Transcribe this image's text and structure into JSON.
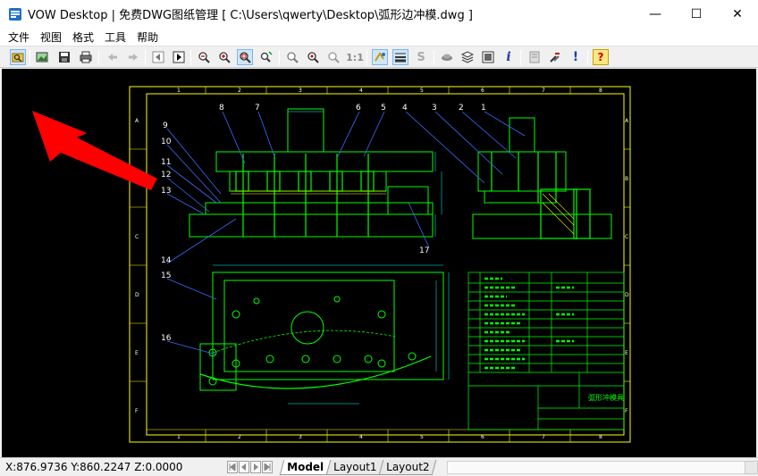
{
  "window": {
    "title": "VOW Desktop | 免费DWG图纸管理 [ C:\\Users\\qwerty\\Desktop\\弧形边冲模.dwg ]",
    "icon": "app-icon"
  },
  "window_controls": {
    "minimize": "—",
    "maximize": "☐",
    "close": "✕"
  },
  "menu": [
    "文件",
    "视图",
    "格式",
    "工具",
    "帮助"
  ],
  "toolbar_icons": [
    "open-file-icon",
    "image-icon",
    "save-icon",
    "print-icon",
    "undo-icon",
    "redo-icon",
    "prev-view-icon",
    "next-view-icon",
    "zoom-out-icon",
    "zoom-in-icon",
    "zoom-window-icon",
    "zoom-realtime-icon",
    "zoom-extents-icon",
    "zoom-center-icon",
    "zoom-previous-icon",
    "zoom-one-to-one-icon",
    "layer-visibility-icon",
    "line-weight-icon",
    "snap-s-icon",
    "3d-view-icon",
    "layers-icon",
    "layout-icon",
    "info-icon",
    "print-preview-icon",
    "tools-icon",
    "alert-icon",
    "help-icon"
  ],
  "labels": {
    "one_to_one": "1:1",
    "s": "S",
    "info": "i",
    "alert": "!",
    "help": "?"
  },
  "drawing": {
    "part_numbers_top": [
      "8",
      "7",
      "6",
      "5",
      "4",
      "3",
      "2",
      "1"
    ],
    "part_numbers_left": [
      "9",
      "10",
      "11",
      "12",
      "13",
      "14",
      "15",
      "16",
      "17"
    ],
    "grid_letters": [
      "A",
      "B",
      "C",
      "D",
      "E",
      "F"
    ],
    "grid_numbers": [
      "1",
      "2",
      "3",
      "4",
      "5",
      "6",
      "7",
      "8"
    ],
    "title_block": "弧形冲模具"
  },
  "status": {
    "coords": "X:876.9736 Y:860.2247 Z:0.0000"
  },
  "tabs": [
    "Model",
    "Layout1",
    "Layout2"
  ],
  "active_tab": "Model",
  "colors": {
    "cad_green": "#00ff00",
    "cad_blue": "#3a6cff",
    "cad_cyan": "#00ffff",
    "cad_white": "#ffffff",
    "cad_yellow": "#ffff00",
    "arrow_red": "#ff0000"
  }
}
